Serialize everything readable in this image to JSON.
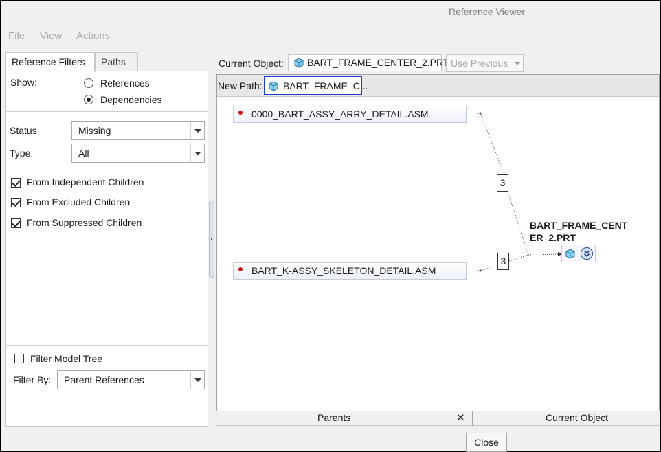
{
  "window": {
    "title": "Reference Viewer"
  },
  "menu": {
    "file": "File",
    "view": "View",
    "actions": "Actions"
  },
  "left_tabs": {
    "reference_filters": "Reference Filters",
    "paths": "Paths"
  },
  "show": {
    "label": "Show:",
    "options": [
      "References",
      "Dependencies"
    ],
    "selected": "Dependencies"
  },
  "status": {
    "label": "Status",
    "value": "Missing"
  },
  "type": {
    "label": "Type:",
    "value": "All"
  },
  "checks": [
    {
      "label": "From Independent Children",
      "checked": true
    },
    {
      "label": "From Excluded Children",
      "checked": true
    },
    {
      "label": "From Suppressed Children",
      "checked": true
    }
  ],
  "filter_model_tree": {
    "label": "Filter Model Tree",
    "checked": false
  },
  "filter_by": {
    "label": "Filter By:",
    "value": "Parent References"
  },
  "current_object": {
    "label": "Current Object:",
    "value": "BART_FRAME_CENTER_2.PRT",
    "use_previous": "Use Previous"
  },
  "new_path": {
    "label": "New Path:",
    "value": "BART_FRAME_C..."
  },
  "graph": {
    "parents": [
      {
        "name": "0000_BART_ASSY_ARRY_DETAIL.ASM",
        "count": "3"
      },
      {
        "name": "BART_K-ASSY_SKELETON_DETAIL.ASM",
        "count": "3"
      }
    ],
    "current": "BART_FRAME_CENTER_2.PRT"
  },
  "bottom_tabs": {
    "parents": "Parents",
    "close_x": "✕",
    "current_object": "Current Object"
  },
  "close_button": "Close",
  "colors": {
    "accent": "#1f3ccf",
    "status_dot": "#d01010",
    "cube": "#5ab4e6"
  }
}
